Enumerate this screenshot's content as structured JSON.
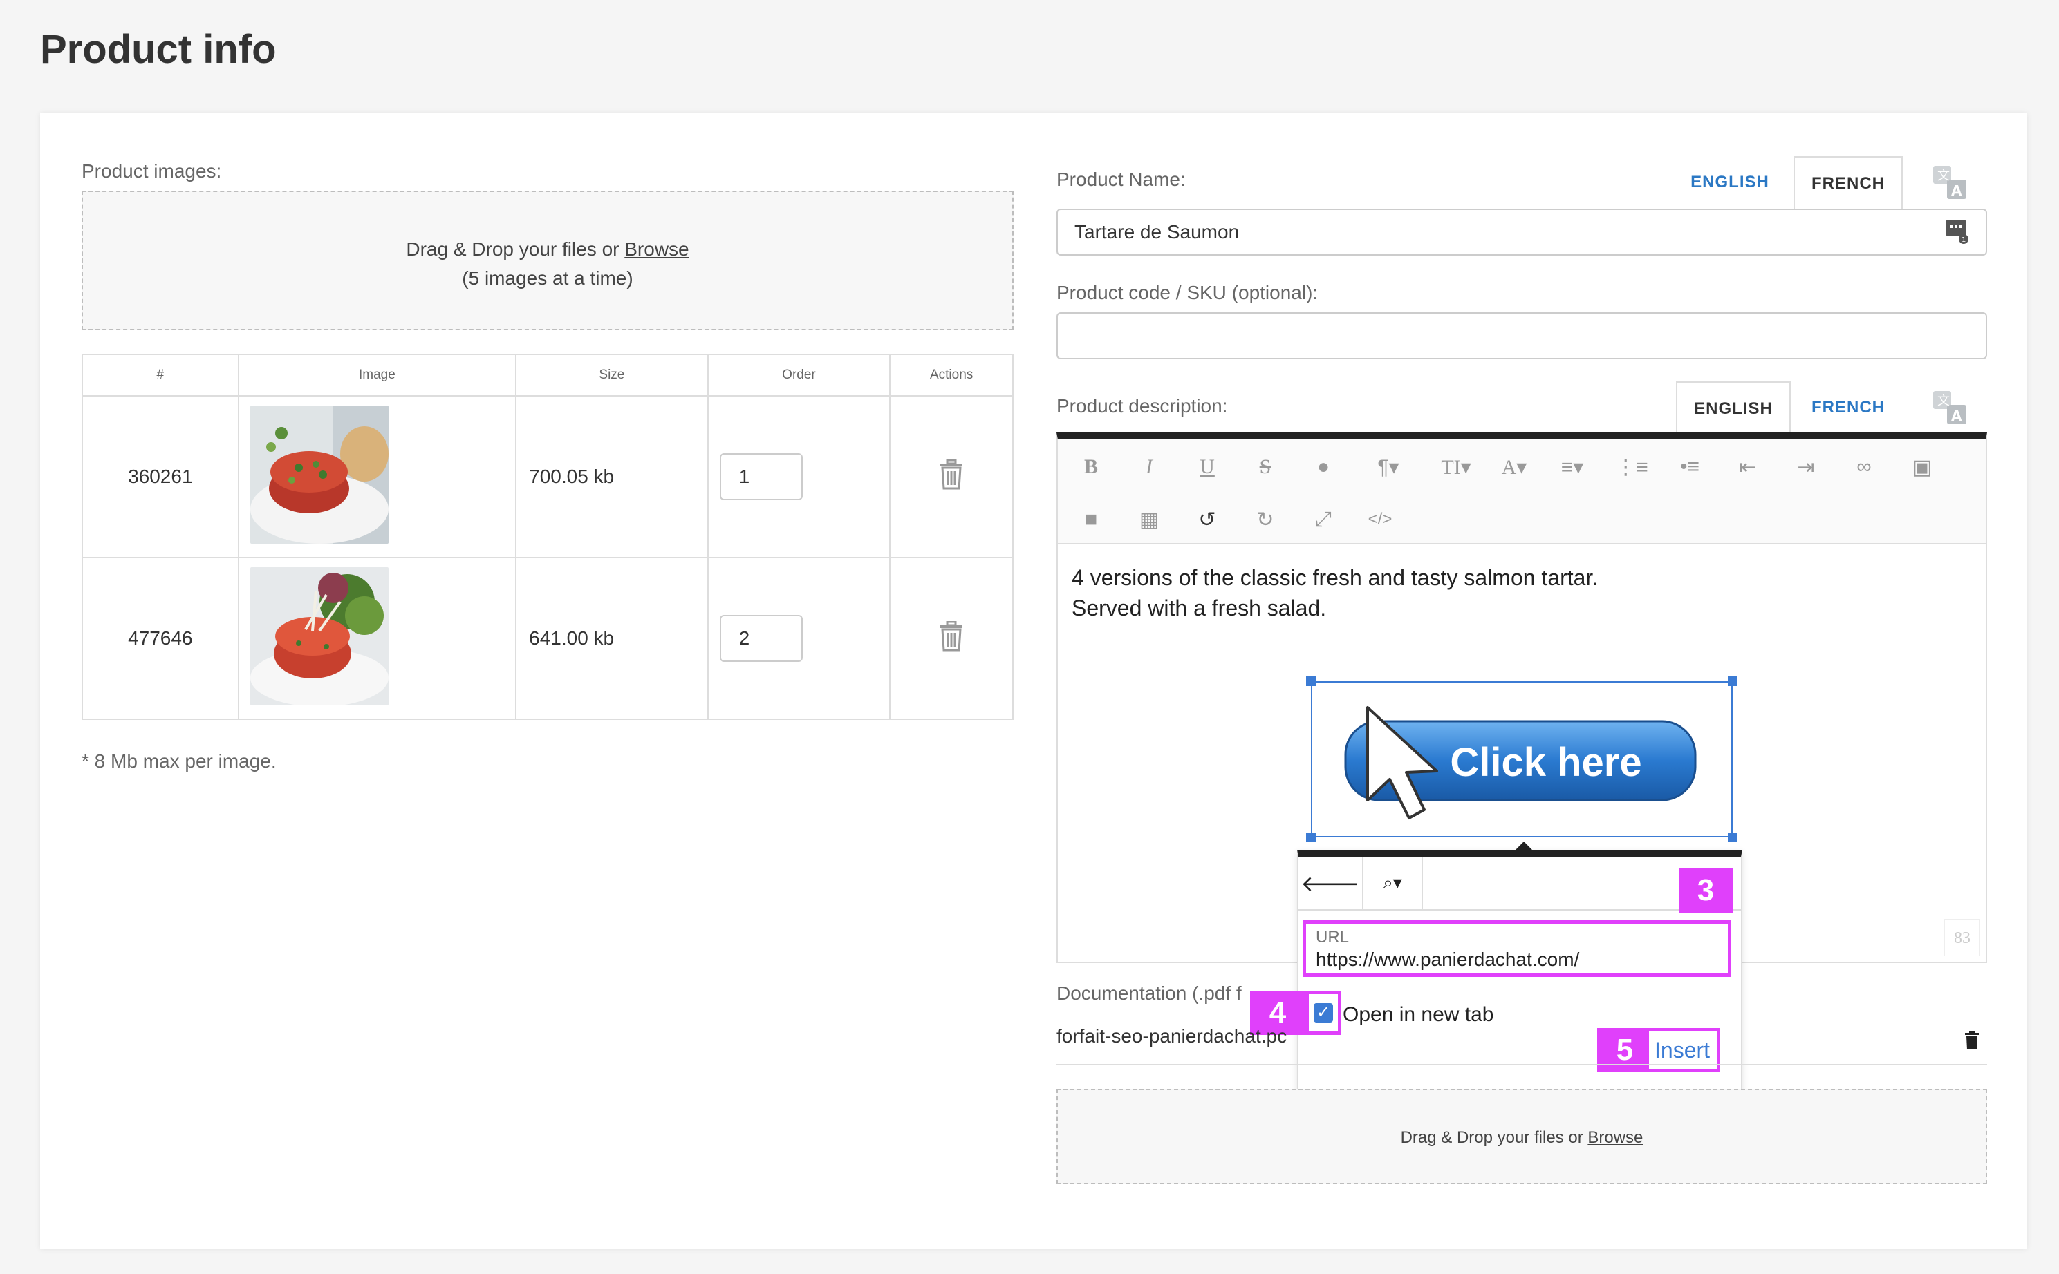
{
  "page": {
    "title": "Product info"
  },
  "images_section": {
    "label": "Product images:",
    "dropzone_text": "Drag & Drop your files or ",
    "dropzone_browse": "Browse",
    "dropzone_sub": "(5 images at a time)",
    "columns": [
      "#",
      "Image",
      "Size",
      "Order",
      "Actions"
    ],
    "rows": [
      {
        "id": "360261",
        "size": "700.05 kb",
        "order": "1"
      },
      {
        "id": "477646",
        "size": "641.00 kb",
        "order": "2"
      }
    ],
    "note": "* 8 Mb max per image."
  },
  "product_name": {
    "label": "Product Name:",
    "value": "Tartare de Saumon",
    "tab_english": "ENGLISH",
    "tab_french": "FRENCH"
  },
  "product_code": {
    "label": "Product code / SKU (optional):",
    "value": ""
  },
  "description": {
    "label": "Product description:",
    "tab_english": "ENGLISH",
    "tab_french": "FRENCH",
    "line1": "4 versions of the classic fresh and tasty salmon tartar.",
    "line2": "Served with a fresh salad.",
    "button_image_text": "Click here",
    "counter": "83"
  },
  "link_popup": {
    "url_label": "URL",
    "url_value": "https://www.panierdachat.com/",
    "open_new_tab_label": "Open in new tab",
    "open_new_tab_checked": true,
    "insert_label": "Insert",
    "badges": [
      "3",
      "4",
      "5"
    ]
  },
  "documentation": {
    "label": "Documentation (.pdf f",
    "file_name": "forfait-seo-panierdachat.pc",
    "dropzone_text": "Drag & Drop your files or ",
    "dropzone_browse": "Browse"
  },
  "colors": {
    "accent": "#2b78c4",
    "highlight": "#e040fb",
    "selection": "#3b7bd4"
  }
}
